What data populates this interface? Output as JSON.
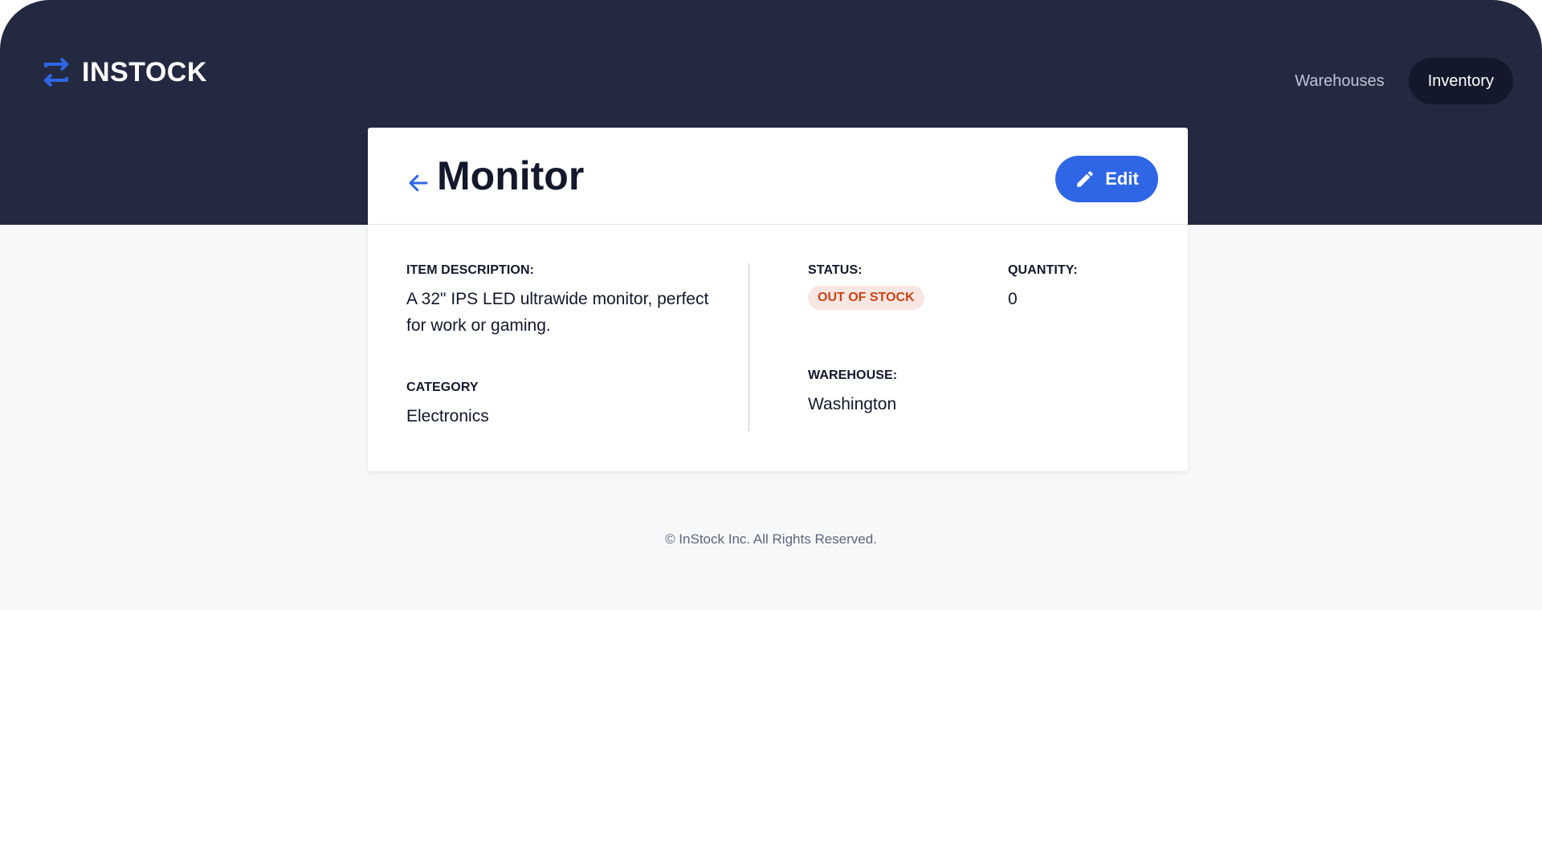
{
  "app": {
    "brand": "INSTOCK",
    "colors": {
      "header_bg": "#232940",
      "accent": "#2e66e6",
      "status_out_of_stock": "#c94515",
      "page_bg": "#f7f8f9"
    }
  },
  "nav": {
    "items": [
      {
        "label": "Warehouses",
        "active": false
      },
      {
        "label": "Inventory",
        "active": true
      }
    ]
  },
  "item": {
    "title": "Monitor",
    "edit_label": "Edit",
    "description_label": "ITEM DESCRIPTION:",
    "description": "A 32\" IPS LED ultrawide monitor, perfect for work or gaming.",
    "category_label": "CATEGORY",
    "category": "Electronics",
    "status_label": "STATUS:",
    "status": "OUT OF STOCK",
    "quantity_label": "QUANTITY:",
    "quantity": "0",
    "warehouse_label": "WAREHOUSE:",
    "warehouse": "Washington"
  },
  "icons": {
    "logo": "swap-arrows-icon",
    "back": "arrow-left-icon",
    "edit": "pencil-icon"
  },
  "footer": {
    "text": "© InStock Inc. All Rights Reserved."
  }
}
